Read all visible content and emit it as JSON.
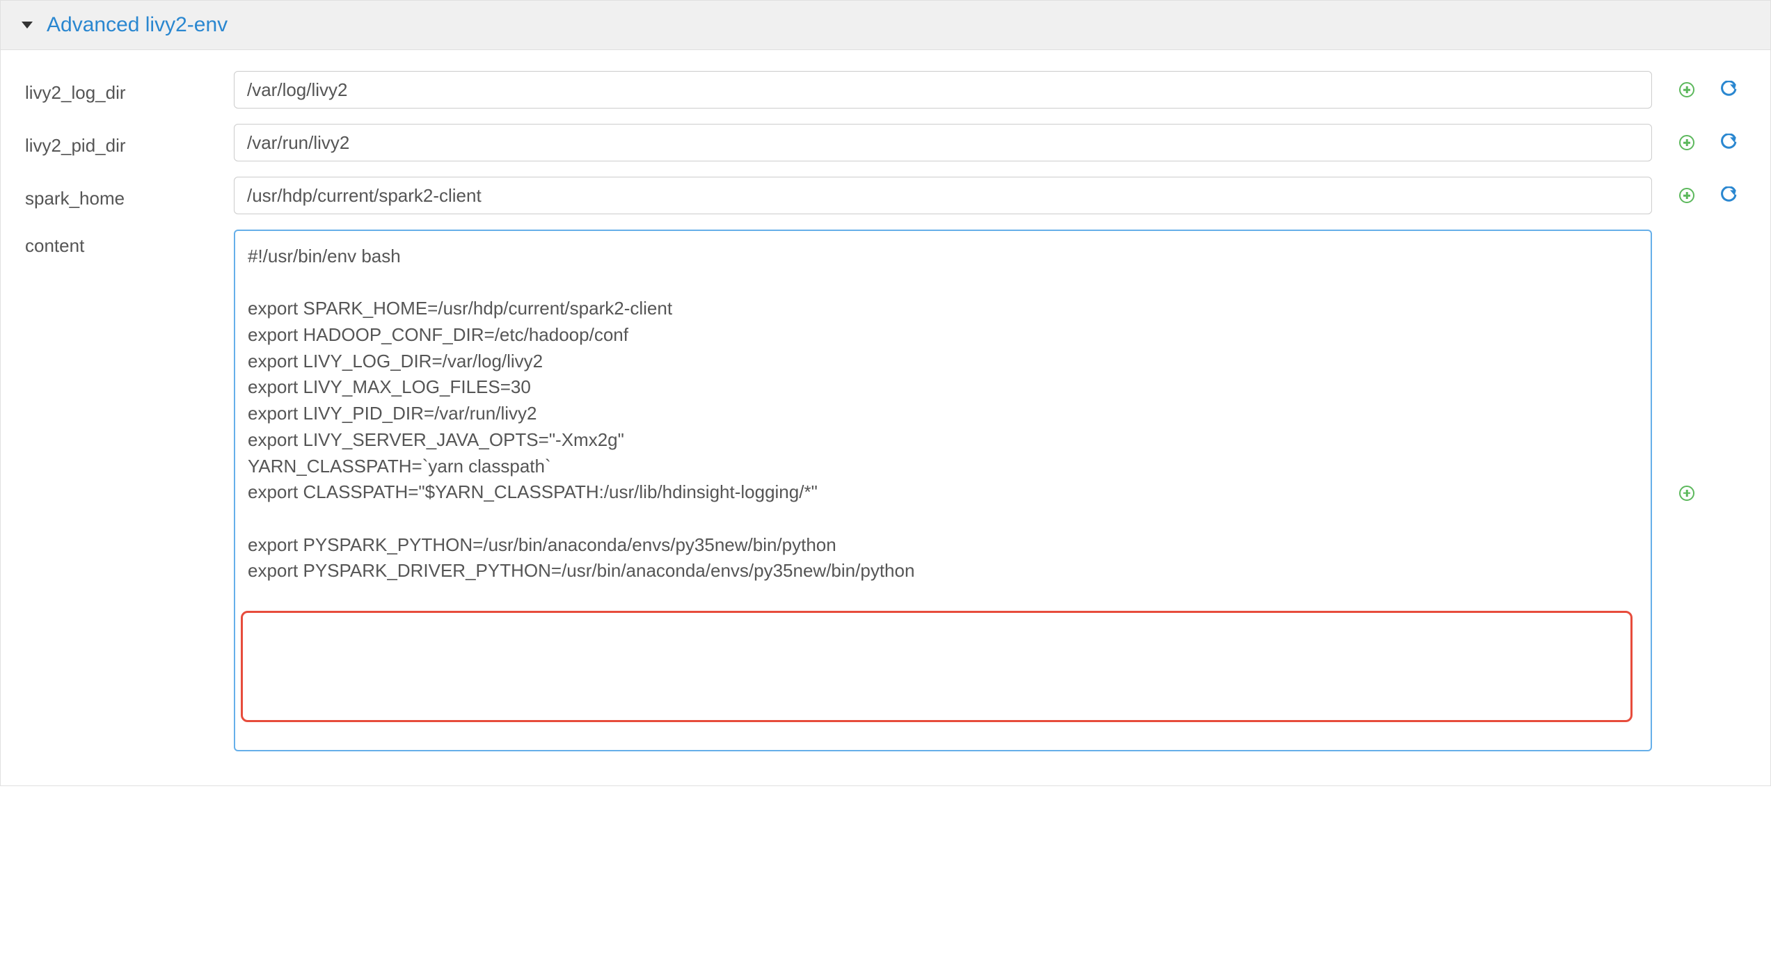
{
  "panel": {
    "title": "Advanced livy2-env"
  },
  "fields": {
    "log_dir": {
      "label": "livy2_log_dir",
      "value": "/var/log/livy2"
    },
    "pid_dir": {
      "label": "livy2_pid_dir",
      "value": "/var/run/livy2"
    },
    "spark_home": {
      "label": "spark_home",
      "value": "/usr/hdp/current/spark2-client"
    },
    "content": {
      "label": "content",
      "value": "#!/usr/bin/env bash\n\nexport SPARK_HOME=/usr/hdp/current/spark2-client\nexport HADOOP_CONF_DIR=/etc/hadoop/conf\nexport LIVY_LOG_DIR=/var/log/livy2\nexport LIVY_MAX_LOG_FILES=30\nexport LIVY_PID_DIR=/var/run/livy2\nexport LIVY_SERVER_JAVA_OPTS=\"-Xmx2g\"\nYARN_CLASSPATH=`yarn classpath`\nexport CLASSPATH=\"$YARN_CLASSPATH:/usr/lib/hdinsight-logging/*\"\n\nexport PYSPARK_PYTHON=/usr/bin/anaconda/envs/py35new/bin/python\nexport PYSPARK_DRIVER_PYTHON=/usr/bin/anaconda/envs/py35new/bin/python\n"
    }
  }
}
